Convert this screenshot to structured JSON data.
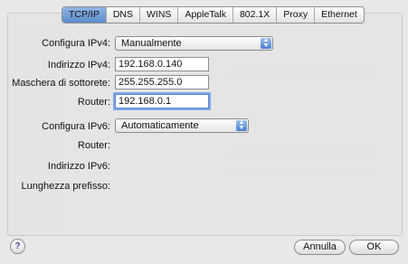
{
  "tabs": [
    {
      "label": "TCP/IP",
      "active": true
    },
    {
      "label": "DNS",
      "active": false
    },
    {
      "label": "WINS",
      "active": false
    },
    {
      "label": "AppleTalk",
      "active": false
    },
    {
      "label": "802.1X",
      "active": false
    },
    {
      "label": "Proxy",
      "active": false
    },
    {
      "label": "Ethernet",
      "active": false
    }
  ],
  "ipv4": {
    "configure_label": "Configura IPv4:",
    "configure_value": "Manualmente",
    "address_label": "Indirizzo IPv4:",
    "address_value": "192.168.0.140",
    "subnet_label": "Maschera di sottorete:",
    "subnet_value": "255.255.255.0",
    "router_label": "Router:",
    "router_value": "192.168.0.1"
  },
  "ipv6": {
    "configure_label": "Configura IPv6:",
    "configure_value": "Automaticamente",
    "router_label": "Router:",
    "address_label": "Indirizzo IPv6:",
    "prefix_label": "Lunghezza prefisso:"
  },
  "buttons": {
    "help": "?",
    "cancel": "Annulla",
    "ok": "OK"
  },
  "colors": {
    "accent": "#5c8ccc",
    "focus_ring": "#7fa9e6"
  }
}
